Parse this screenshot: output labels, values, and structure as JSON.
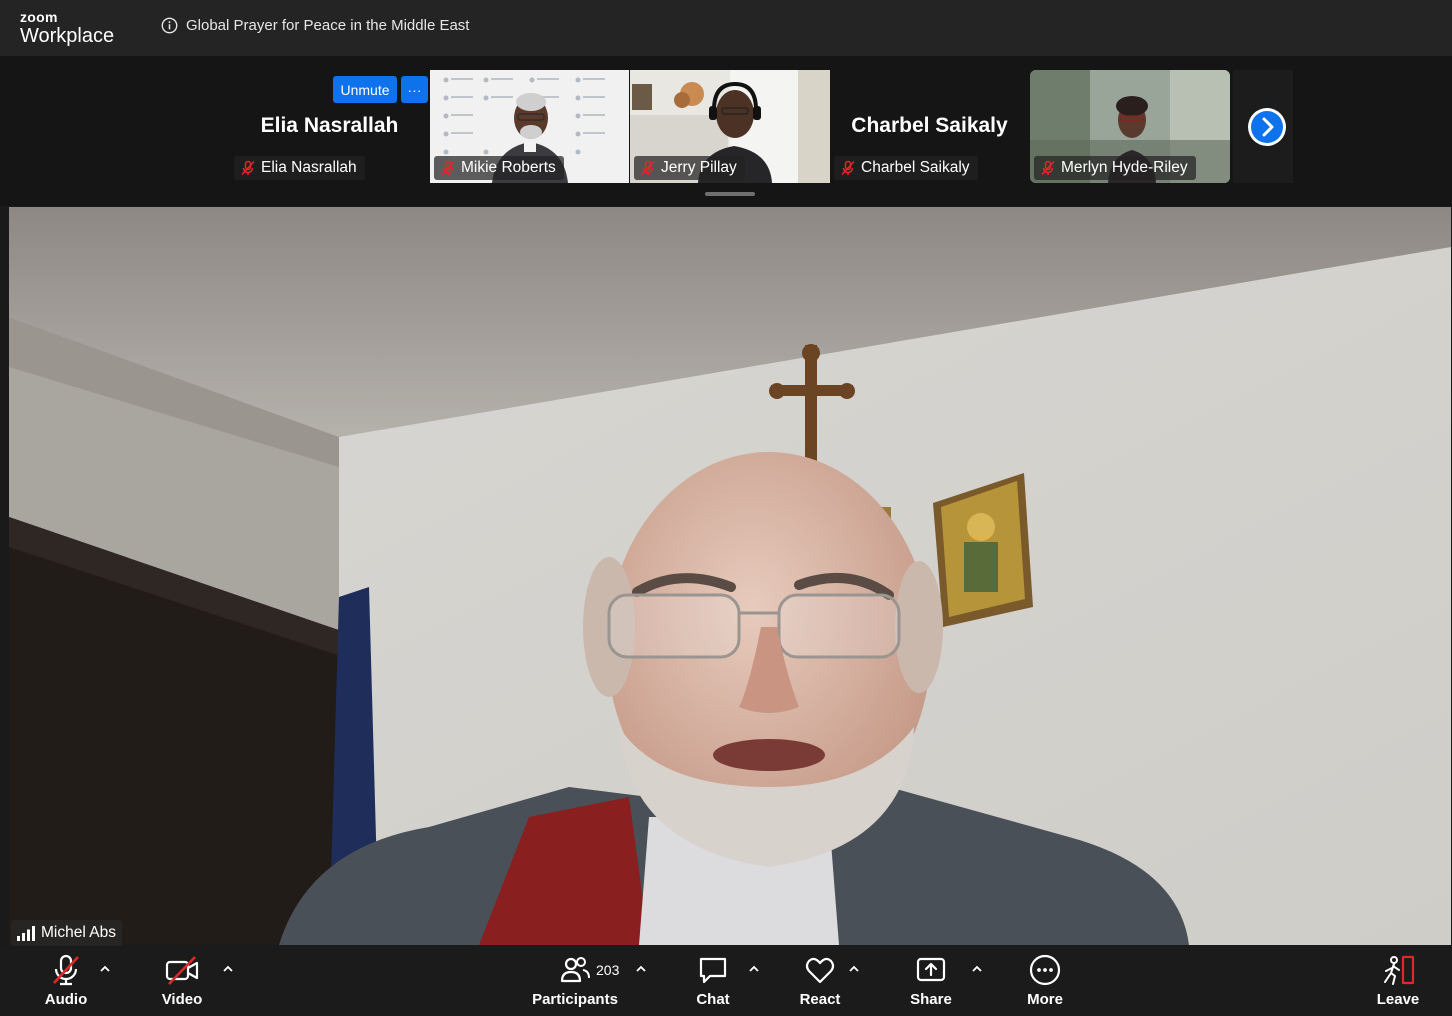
{
  "app": {
    "brand_small": "zoom",
    "brand_name": "Workplace"
  },
  "meeting": {
    "title": "Global Prayer for Peace in the Middle East"
  },
  "gallery": {
    "unmute_label": "Unmute",
    "more_label": "···",
    "tiles": [
      {
        "name": "Elia Nasrallah",
        "big_name": "Elia Nasrallah",
        "video": false
      },
      {
        "name": "Mikie Roberts",
        "video": true
      },
      {
        "name": "Jerry Pillay",
        "video": true
      },
      {
        "name": "Charbel Saikaly",
        "big_name": "Charbel Saikaly",
        "video": false
      },
      {
        "name": "Merlyn Hyde-Riley",
        "video": true
      }
    ]
  },
  "speaker": {
    "name": "Michel Abs"
  },
  "toolbar": {
    "audio": "Audio",
    "video": "Video",
    "participants": "Participants",
    "participants_count": "203",
    "chat": "Chat",
    "react": "React",
    "share": "Share",
    "more": "More",
    "leave": "Leave"
  },
  "colors": {
    "accent": "#0e72ed",
    "mute_red": "#e02828",
    "leave_red": "#e02828",
    "background": "#1a1a1a"
  }
}
